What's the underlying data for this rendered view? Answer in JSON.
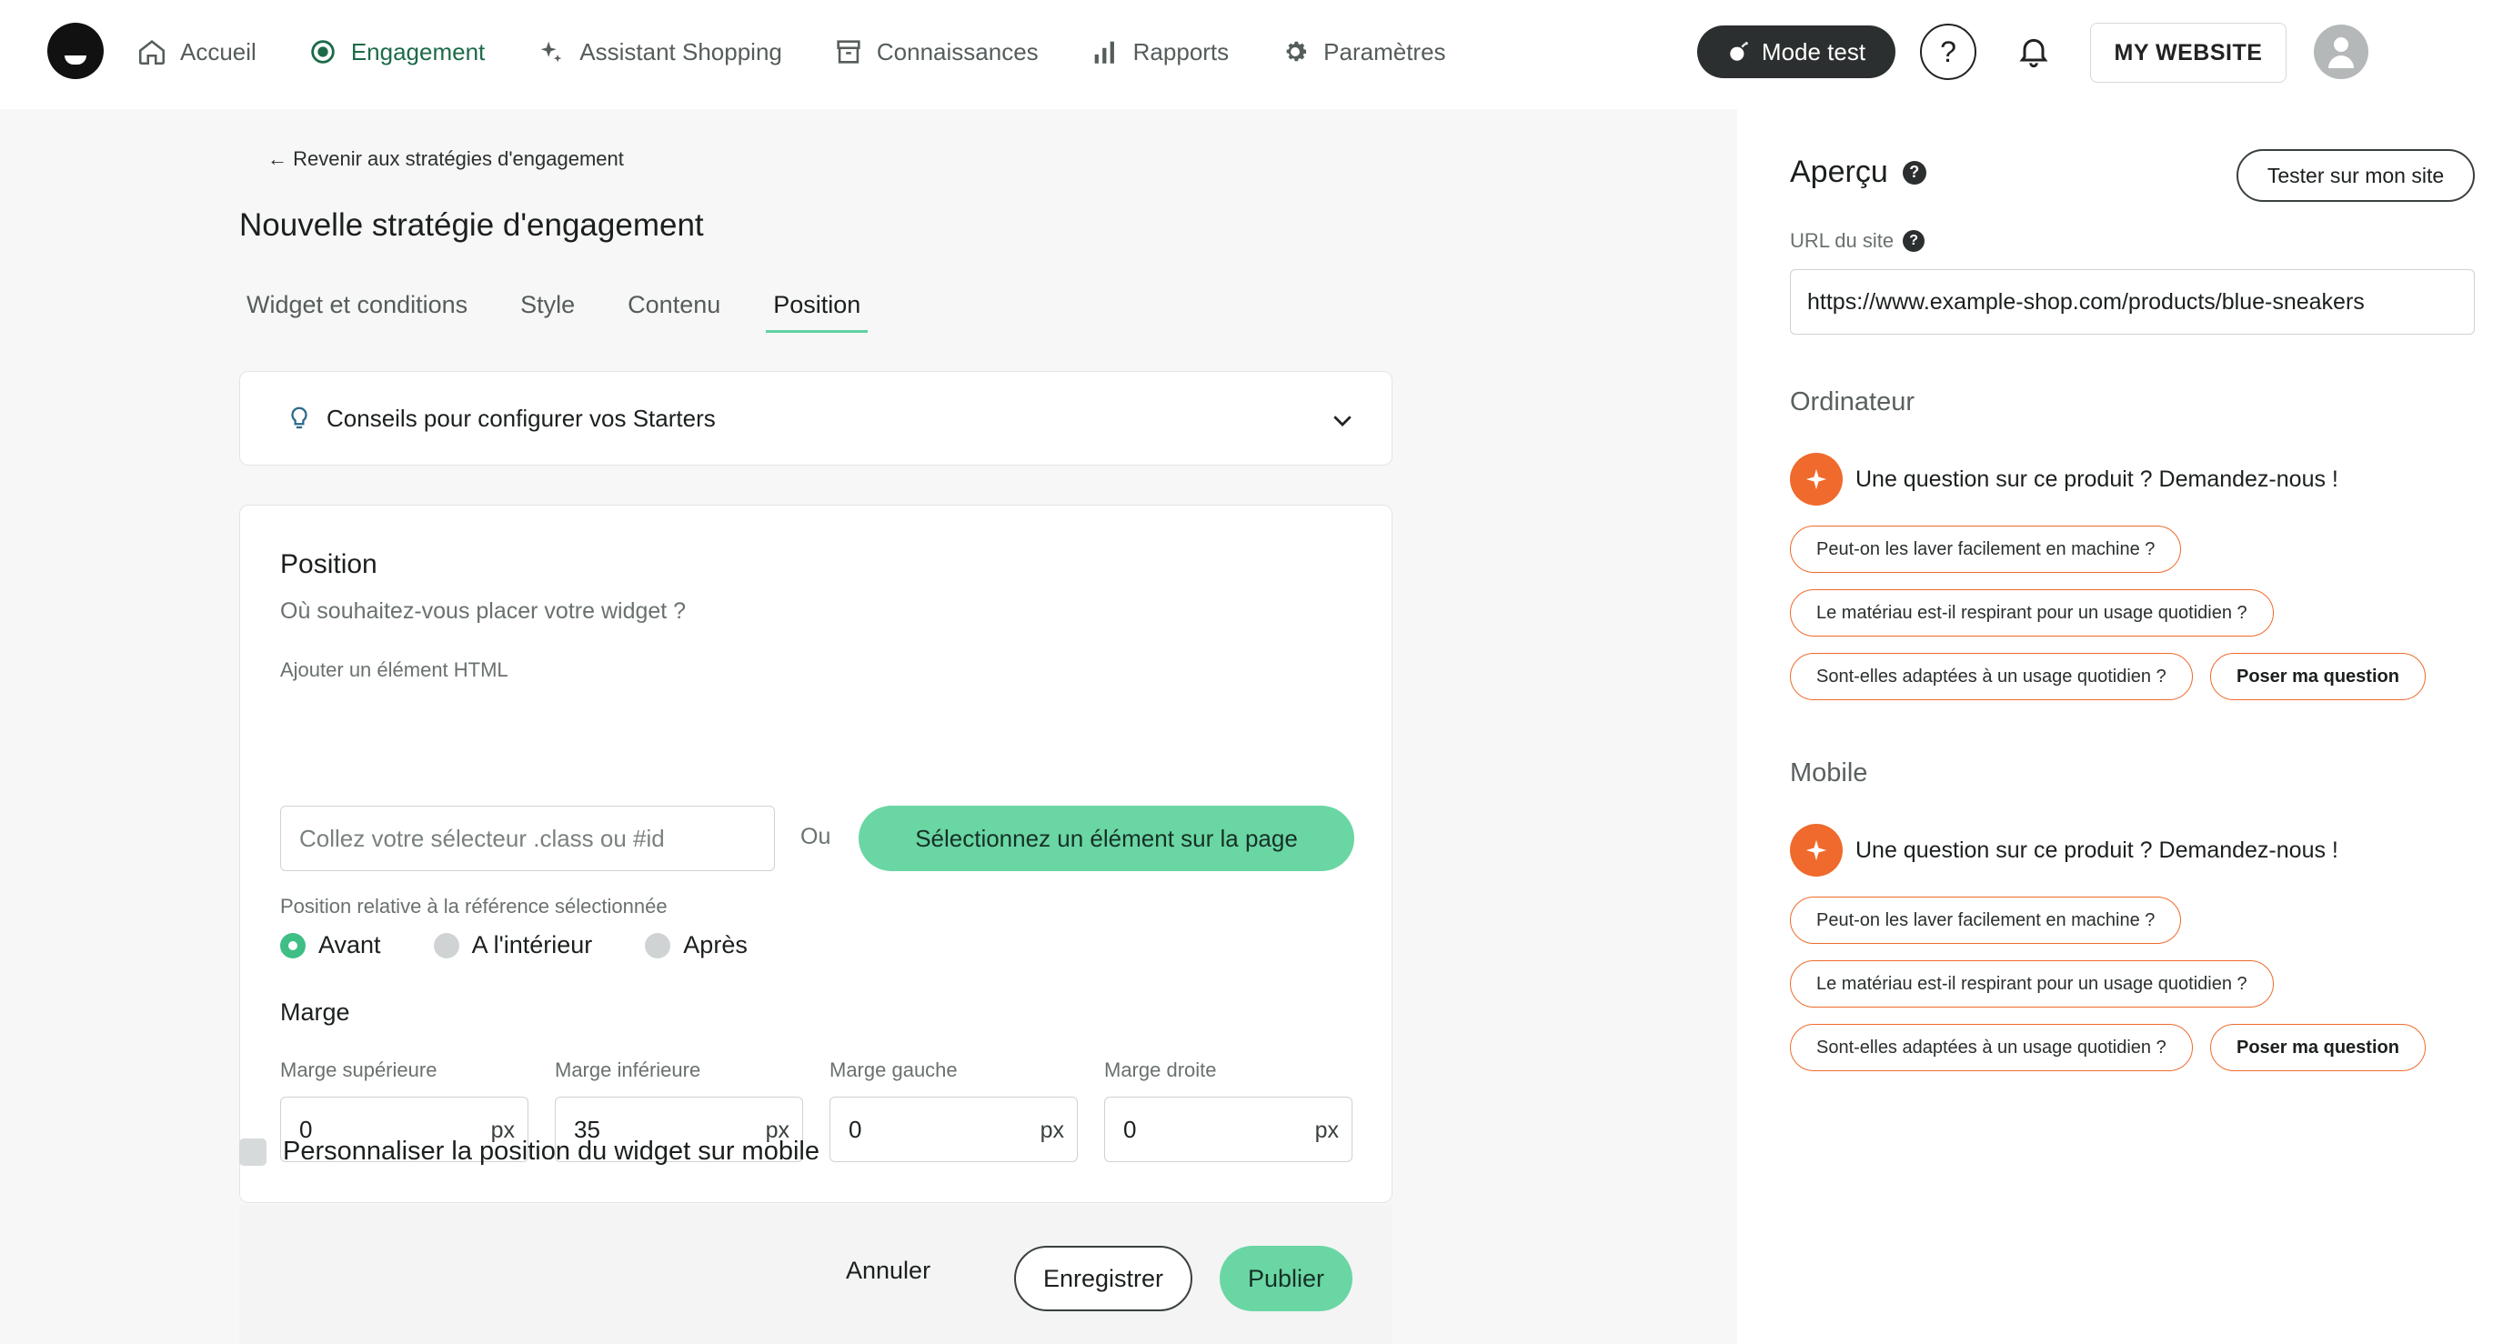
{
  "nav": {
    "items": [
      {
        "label": "Accueil",
        "icon": "home-icon"
      },
      {
        "label": "Engagement",
        "icon": "target-icon"
      },
      {
        "label": "Assistant Shopping",
        "icon": "sparkle-icon"
      },
      {
        "label": "Connaissances",
        "icon": "archive-icon"
      },
      {
        "label": "Rapports",
        "icon": "bar-chart-icon"
      },
      {
        "label": "Paramètres",
        "icon": "gear-icon"
      }
    ],
    "active": "Engagement",
    "mode_test": "Mode test",
    "help": "?",
    "site": "MY WEBSITE"
  },
  "main": {
    "back": "← Revenir aux stratégies d'engagement",
    "title": "Nouvelle stratégie d'engagement",
    "tabs": [
      "Widget et conditions",
      "Style",
      "Contenu",
      "Position"
    ],
    "active_tab": "Position",
    "tips": "Conseils pour configurer vos Starters",
    "card": {
      "heading": "Position",
      "subtitle": "Où souhaitez-vous placer votre widget ?",
      "html_label": "Ajouter un élément HTML",
      "selector_placeholder": "Collez votre sélecteur .class ou #id",
      "or": "Ou",
      "select_button": "Sélectionnez un élément sur la page",
      "relative_label": "Position relative à la référence sélectionnée",
      "radios": [
        "Avant",
        "A l'intérieur",
        "Après"
      ],
      "radio_selected": "Avant",
      "marge_heading": "Marge",
      "margins": [
        {
          "label": "Marge supérieure",
          "value": "0",
          "unit": "px"
        },
        {
          "label": "Marge inférieure",
          "value": "35",
          "unit": "px"
        },
        {
          "label": "Marge gauche",
          "value": "0",
          "unit": "px"
        },
        {
          "label": "Marge droite",
          "value": "0",
          "unit": "px"
        }
      ]
    },
    "mobile_checkbox": "Personnaliser la position du widget sur mobile",
    "actions": {
      "cancel": "Annuler",
      "save": "Enregistrer",
      "publish": "Publier"
    }
  },
  "preview": {
    "title": "Aperçu",
    "test_button": "Tester sur mon site",
    "url_label": "URL du site",
    "url_value": "https://www.example-shop.com/products/blue-sneakers",
    "desktop": {
      "heading": "Ordinateur",
      "widget_title": "Une question sur ce produit ? Demandez-nous !",
      "chips": [
        "Peut-on les laver facilement en machine ?",
        "Le matériau est-il respirant pour un usage quotidien ?",
        "Sont-elles adaptées à un usage quotidien ?",
        "Poser ma question"
      ]
    },
    "mobile": {
      "heading": "Mobile",
      "widget_title": "Une question sur ce produit ? Demandez-nous !",
      "chips": [
        "Peut-on les laver facilement en machine ?",
        "Le matériau est-il respirant pour un usage quotidien ?",
        "Sont-elles adaptées à un usage quotidien ?",
        "Poser ma question"
      ]
    }
  },
  "colors": {
    "accent_green": "#6ad6a4",
    "active_nav": "#1c6b48",
    "orange": "#ef6a2c"
  }
}
